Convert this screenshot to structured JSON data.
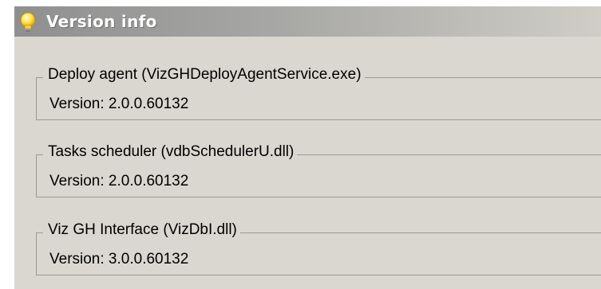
{
  "header": {
    "title": "Version info",
    "icon": "lightbulb-icon",
    "bulb_color": "#ffe24a"
  },
  "components": [
    {
      "name": "Deploy agent (VizGHDeployAgentService.exe)",
      "version": "Version: 2.0.0.60132"
    },
    {
      "name": "Tasks scheduler (vdbSchedulerU.dll)",
      "version": "Version: 2.0.0.60132"
    },
    {
      "name": "Viz GH Interface (VizDbI.dll)",
      "version": "Version: 3.0.0.60132"
    }
  ]
}
